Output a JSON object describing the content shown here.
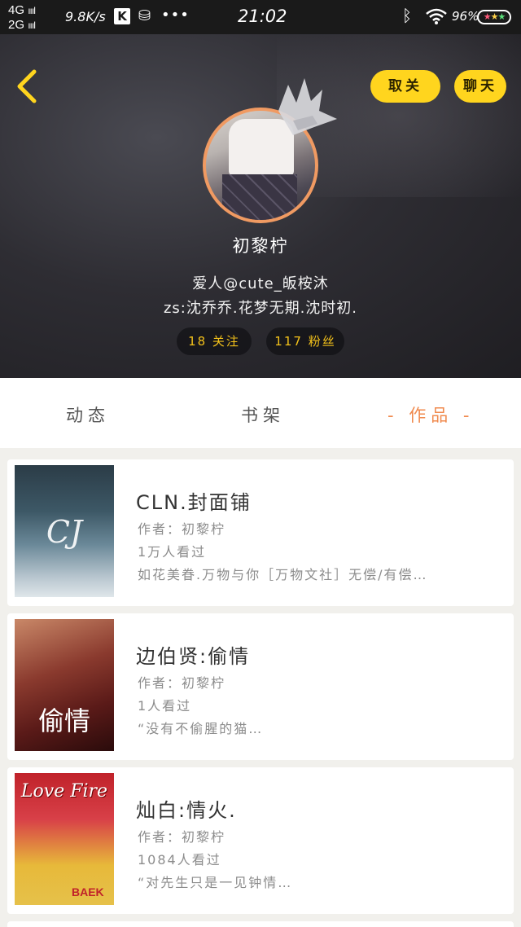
{
  "status_bar": {
    "network_top": "4G",
    "network_bottom": "2G",
    "speed": "9.8K/s",
    "app_icon_k": "K",
    "time": "21:02",
    "battery": "96%"
  },
  "header": {
    "unfollow_label": "取关",
    "chat_label": "聊天",
    "username": "初黎柠",
    "bio_line1": "爱人@cute_皈桉沐",
    "bio_line2": "zs:沈乔乔.花梦无期.沈时初.",
    "following": "18 关注",
    "fans": "117 粉丝"
  },
  "tabs": {
    "dynamic": "动态",
    "shelf": "书架",
    "works": "- 作品 -"
  },
  "works": [
    {
      "title": "CLN.封面铺",
      "author": "作者：初黎柠",
      "views": "1万人看过",
      "desc": "如花美眷.万物与你［万物文社］无偿/有偿…",
      "cover_text": "CJ"
    },
    {
      "title": "边伯贤:偷情",
      "author": "作者：初黎柠",
      "views": "1人看过",
      "desc": "“没有不偷腥的猫…",
      "cover_text": "偷情"
    },
    {
      "title": "灿白:情火.",
      "author": "作者：初黎柠",
      "views": "1084人看过",
      "desc": "“对先生只是一见钟情…",
      "cover_text": "Love Fire",
      "cover_tag": "BAEK"
    }
  ],
  "colors": {
    "accent": "#f08a4e",
    "pill_yellow": "#ffd51e",
    "stat_text": "#f4c21a"
  },
  "icons": [
    "back-icon",
    "crown-icon",
    "bluetooth-icon",
    "wifi-icon",
    "battery-icon",
    "database-icon",
    "more-dots-icon"
  ]
}
